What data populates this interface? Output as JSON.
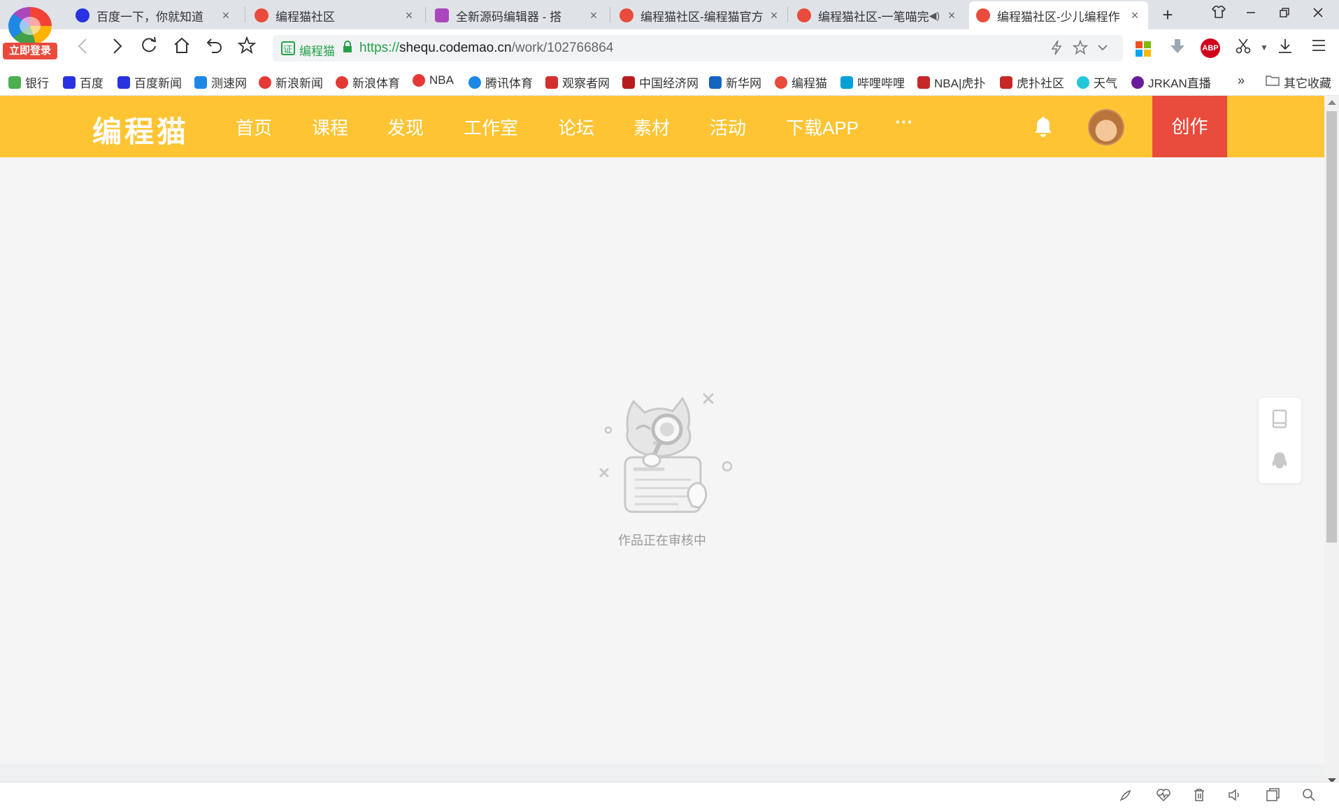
{
  "browser": {
    "login_badge": "立即登录",
    "tabs": [
      {
        "title": "百度一下，你就知道",
        "close": "×",
        "icon_color": "#2932e1"
      },
      {
        "title": "编程猫社区",
        "close": "×",
        "icon_color": "#e94b3c"
      },
      {
        "title": "全新源码编辑器 - 搭",
        "close": "×",
        "icon_color": "#ab47bc"
      },
      {
        "title": "编程猫社区-编程猫官方",
        "close": "×",
        "icon_color": "#e94b3c"
      },
      {
        "title": "编程猫社区-一笔喵完",
        "close": "×",
        "icon_color": "#e94b3c"
      },
      {
        "title": "编程猫社区-少儿编程作",
        "close": "×",
        "icon_color": "#e94b3c"
      }
    ],
    "new_tab": "+",
    "url": {
      "site_name": "编程猫",
      "scheme": "https://",
      "host": "shequ.codemao.cn",
      "path": "/work/102766864"
    },
    "bookmarks": [
      {
        "label": "银行",
        "icon_color": "#4caf50"
      },
      {
        "label": "百度",
        "icon_color": "#2932e1"
      },
      {
        "label": "百度新闻",
        "icon_color": "#2932e1"
      },
      {
        "label": "测速网",
        "icon_color": "#1e88e5"
      },
      {
        "label": "新浪新闻",
        "icon_color": "#e53935"
      },
      {
        "label": "新浪体育",
        "icon_color": "#e53935"
      },
      {
        "label": "NBA",
        "icon_color": "#e53935"
      },
      {
        "label": "腾讯体育",
        "icon_color": "#1e88e5"
      },
      {
        "label": "观察者网",
        "icon_color": "#d32f2f"
      },
      {
        "label": "中国经济网",
        "icon_color": "#b71c1c"
      },
      {
        "label": "新华网",
        "icon_color": "#1565c0"
      },
      {
        "label": "编程猫",
        "icon_color": "#e94b3c"
      },
      {
        "label": "哔哩哔哩",
        "icon_color": "#00a1d6"
      },
      {
        "label": "NBA|虎扑",
        "icon_color": "#c62828"
      },
      {
        "label": "虎扑社区",
        "icon_color": "#c62828"
      },
      {
        "label": "天气",
        "icon_color": "#26c6da"
      },
      {
        "label": "JRKAN直播",
        "icon_color": "#6a1b9a"
      }
    ],
    "bookmarks_more": "»",
    "other_bookmarks": "其它收藏"
  },
  "page": {
    "brand": "编程猫",
    "nav": [
      "首页",
      "课程",
      "发现",
      "工作室",
      "论坛",
      "素材",
      "活动",
      "下载APP"
    ],
    "more": "···",
    "create_label": "创作",
    "empty_message": "作品正在审核中",
    "colors": {
      "header": "#fec433",
      "create": "#e94b3c",
      "background": "#f5f5f5"
    }
  }
}
